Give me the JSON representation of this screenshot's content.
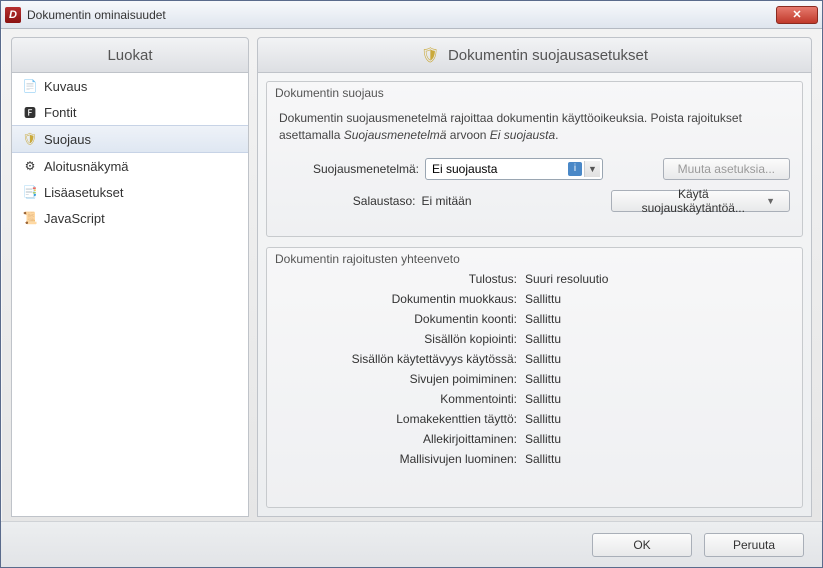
{
  "window": {
    "title": "Dokumentin ominaisuudet"
  },
  "sidebar": {
    "header": "Luokat",
    "items": [
      {
        "label": "Kuvaus",
        "icon": "📄"
      },
      {
        "label": "Fontit",
        "icon": "🅵"
      },
      {
        "label": "Suojaus",
        "icon": "🛡"
      },
      {
        "label": "Aloitusnäkymä",
        "icon": "⚙"
      },
      {
        "label": "Lisäasetukset",
        "icon": "📑"
      },
      {
        "label": "JavaScript",
        "icon": "📜"
      }
    ],
    "selected_index": 2
  },
  "main": {
    "title": "Dokumentin suojausasetukset",
    "security_group": {
      "title": "Dokumentin suojaus",
      "description_pre": "Dokumentin suojausmenetelmä rajoittaa dokumentin käyttöoikeuksia. Poista rajoitukset asettamalla ",
      "description_em": "Suojausmenetelmä",
      "description_mid": " arvoon ",
      "description_em2": "Ei suojausta",
      "description_post": ".",
      "method_label": "Suojausmenetelmä:",
      "method_value": "Ei suojausta",
      "change_settings_btn": "Muuta asetuksia...",
      "encryption_label": "Salaustaso:",
      "encryption_value": "Ei mitään",
      "policy_btn": "Käytä suojauskäytäntöä..."
    },
    "summary_group": {
      "title": "Dokumentin rajoitusten yhteenveto",
      "rows": [
        {
          "label": "Tulostus:",
          "value": "Suuri resoluutio"
        },
        {
          "label": "Dokumentin muokkaus:",
          "value": "Sallittu"
        },
        {
          "label": "Dokumentin koonti:",
          "value": "Sallittu"
        },
        {
          "label": "Sisällön kopiointi:",
          "value": "Sallittu"
        },
        {
          "label": "Sisällön käytettävyys käytössä:",
          "value": "Sallittu"
        },
        {
          "label": "Sivujen poimiminen:",
          "value": "Sallittu"
        },
        {
          "label": "Kommentointi:",
          "value": "Sallittu"
        },
        {
          "label": "Lomakekenttien täyttö:",
          "value": "Sallittu"
        },
        {
          "label": "Allekirjoittaminen:",
          "value": "Sallittu"
        },
        {
          "label": "Mallisivujen luominen:",
          "value": "Sallittu"
        }
      ]
    }
  },
  "footer": {
    "ok": "OK",
    "cancel": "Peruuta"
  }
}
